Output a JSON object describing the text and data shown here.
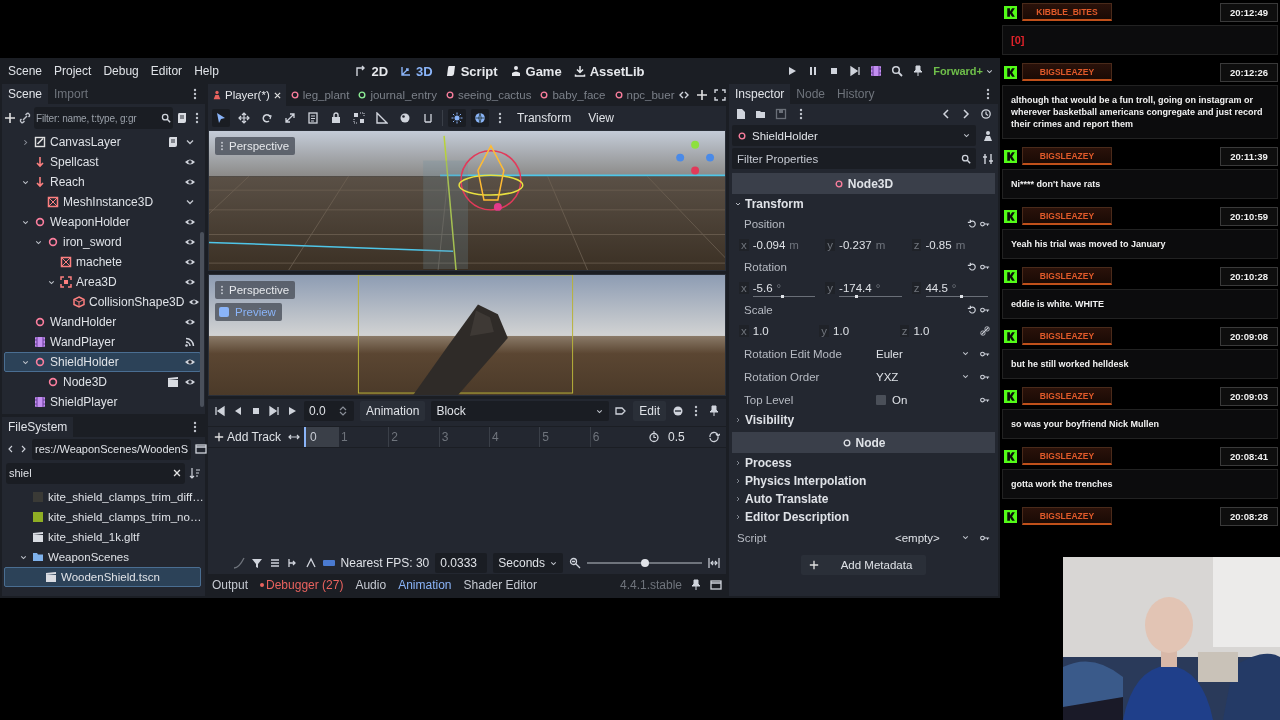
{
  "menu": [
    "Scene",
    "Project",
    "Debug",
    "Editor",
    "Help"
  ],
  "workspaces": [
    {
      "label": "2D",
      "kind": "planar",
      "selected": false
    },
    {
      "label": "3D",
      "kind": "spatial",
      "selected": true
    },
    {
      "label": "Script",
      "kind": "script",
      "selected": false
    },
    {
      "label": "Game",
      "kind": "game",
      "selected": false
    },
    {
      "label": "AssetLib",
      "kind": "assetlib",
      "selected": false
    }
  ],
  "renderer": "Forward+",
  "scene_dock": {
    "tabs": [
      {
        "label": "Scene",
        "selected": true
      },
      {
        "label": "Import",
        "selected": false
      }
    ],
    "filter_placeholder": "Filter: name, t:type, g:gr",
    "tree": [
      {
        "label": "CanvasLayer",
        "kind": "canvas_layer",
        "has_script": true,
        "folded": true,
        "expanded": false,
        "selected": false
      },
      {
        "label": "Spellcast",
        "kind": "marker",
        "visible": true,
        "selected": false
      },
      {
        "label": "Reach",
        "kind": "marker",
        "visible": true,
        "expanded": true,
        "selected": false,
        "children": [
          {
            "label": "MeshInstance3D",
            "kind": "mesh",
            "folded": true,
            "selected": false
          }
        ]
      },
      {
        "label": "WeaponHolder",
        "kind": "node3d",
        "visible": true,
        "expanded": true,
        "selected": false,
        "children": [
          {
            "label": "iron_sword",
            "kind": "node3d",
            "visible": true,
            "expanded": true,
            "selected": false,
            "children": [
              {
                "label": "machete",
                "kind": "mesh",
                "visible": true,
                "selected": false
              },
              {
                "label": "Area3D",
                "kind": "area",
                "visible": true,
                "expanded": true,
                "selected": false,
                "children": [
                  {
                    "label": "CollisionShape3D",
                    "kind": "collision",
                    "visible": true,
                    "selected": false
                  }
                ]
              }
            ]
          }
        ]
      },
      {
        "label": "WandHolder",
        "kind": "node3d",
        "visible": true,
        "selected": false
      },
      {
        "label": "WandPlayer",
        "kind": "animation_player",
        "has_signals": true,
        "selected": false
      },
      {
        "label": "ShieldHolder",
        "kind": "node3d",
        "visible": true,
        "expanded": true,
        "selected": true,
        "children": [
          {
            "label": "Node3D",
            "kind": "node3d",
            "instanced": true,
            "visible": true,
            "selected": false
          }
        ]
      },
      {
        "label": "ShieldPlayer",
        "kind": "animation_player",
        "selected": false
      }
    ]
  },
  "filesystem": {
    "tab": "FileSystem",
    "path": "res://WeaponScenes/WoodenS",
    "search": "shiel",
    "tree": [
      {
        "label": "kite_shield_clamps_trim_diff…",
        "kind": "texture",
        "color": "#3a3a36",
        "selected": false
      },
      {
        "label": "kite_shield_clamps_trim_no…",
        "kind": "texture",
        "color": "#8fae24",
        "selected": false
      },
      {
        "label": "kite_shield_1k.gltf",
        "kind": "scene",
        "selected": false
      },
      {
        "label": "WeaponScenes",
        "kind": "folder",
        "expanded": true,
        "selected": false,
        "children": [
          {
            "label": "WoodenShield.tscn",
            "kind": "scene",
            "selected": true
          }
        ]
      }
    ]
  },
  "scene_tabs": [
    {
      "label": "Player(*)",
      "kind": "character",
      "color": "#e8625e",
      "selected": true
    },
    {
      "label": "leg_plant",
      "kind": "node",
      "color": "#fc7f9e",
      "selected": false
    },
    {
      "label": "journal_entry",
      "kind": "node",
      "color": "#8eef97",
      "selected": false
    },
    {
      "label": "seeing_cactus",
      "kind": "node",
      "color": "#fc7f9e",
      "selected": false
    },
    {
      "label": "baby_face",
      "kind": "node",
      "color": "#fc7f9e",
      "selected": false
    },
    {
      "label": "npc_buer",
      "kind": "node",
      "color": "#fc7f9e",
      "selected": false
    }
  ],
  "viewport_toolbar": {
    "tools": [
      {
        "kind": "select",
        "selected": true
      },
      {
        "kind": "move",
        "selected": false
      },
      {
        "kind": "rotate",
        "selected": false
      },
      {
        "kind": "scale",
        "selected": false
      },
      {
        "kind": "list",
        "selected": false
      },
      {
        "kind": "lock",
        "selected": false
      },
      {
        "kind": "group",
        "selected": false
      },
      {
        "kind": "ruler",
        "selected": false
      },
      {
        "kind": "sphere",
        "selected": false
      },
      {
        "kind": "snap",
        "selected": false
      },
      {
        "kind": "sun",
        "selected": true
      },
      {
        "kind": "globe",
        "selected": true
      }
    ],
    "menus": [
      "Transform",
      "View"
    ]
  },
  "viewports": [
    {
      "label": "Perspective",
      "kind": "editor"
    },
    {
      "label": "Perspective",
      "kind": "camera",
      "preview": {
        "label": "Preview",
        "checked": true
      }
    }
  ],
  "animation": {
    "time": "0.0",
    "menu": "Animation",
    "current": "Block",
    "edit": "Edit",
    "add_track": "Add Track",
    "cursor": "0",
    "ticks": [
      "1",
      "2",
      "3",
      "4",
      "5",
      "6"
    ],
    "length": "0.5",
    "snap_label": "Nearest FPS: 30",
    "step": "0.0333",
    "unit": "Seconds",
    "zoom": {
      "level": 0.5
    }
  },
  "bottom_tabs": [
    {
      "label": "Output",
      "kind": "plain",
      "selected": false
    },
    {
      "label": "Debugger (27)",
      "kind": "alert",
      "selected": false
    },
    {
      "label": "Audio",
      "kind": "plain",
      "selected": false
    },
    {
      "label": "Animation",
      "kind": "plain",
      "selected": true
    },
    {
      "label": "Shader Editor",
      "kind": "plain",
      "selected": false
    }
  ],
  "version": "4.4.1.stable",
  "inspector": {
    "tabs": [
      {
        "label": "Inspector",
        "selected": true
      },
      {
        "label": "Node",
        "selected": false
      },
      {
        "label": "History",
        "selected": false
      }
    ],
    "node_path": "ShieldHolder",
    "filter_placeholder": "Filter Properties",
    "properties": [
      {
        "kind": "class_header",
        "label": "Node3D"
      },
      {
        "kind": "group",
        "label": "Transform",
        "expanded": true
      },
      {
        "kind": "vector",
        "label": "Position",
        "components": [
          {
            "axis": "x",
            "value": "-0.094",
            "unit": "m"
          },
          {
            "axis": "y",
            "value": "-0.237",
            "unit": "m"
          },
          {
            "axis": "z",
            "value": "-0.85",
            "unit": "m"
          }
        ]
      },
      {
        "kind": "vector",
        "label": "Rotation",
        "components": [
          {
            "axis": "x",
            "value": "-5.6",
            "unit": "°",
            "level": 0.47
          },
          {
            "axis": "y",
            "value": "-174.4",
            "unit": "°",
            "level": 0.27
          },
          {
            "axis": "z",
            "value": "44.5",
            "unit": "°",
            "level": 0.57
          }
        ]
      },
      {
        "kind": "vector",
        "label": "Scale",
        "components": [
          {
            "axis": "x",
            "value": "1.0"
          },
          {
            "axis": "y",
            "value": "1.0"
          },
          {
            "axis": "z",
            "value": "1.0"
          }
        ]
      },
      {
        "kind": "dropdown",
        "label": "Rotation Edit Mode",
        "value": "Euler"
      },
      {
        "kind": "dropdown",
        "label": "Rotation Order",
        "value": "YXZ"
      },
      {
        "kind": "checkbox",
        "label": "Top Level",
        "text": "On",
        "checked": false
      },
      {
        "kind": "group",
        "label": "Visibility",
        "expanded": false
      },
      {
        "kind": "class_header",
        "label": "Node"
      },
      {
        "kind": "group",
        "label": "Process",
        "expanded": false
      },
      {
        "kind": "group",
        "label": "Physics Interpolation",
        "expanded": false
      },
      {
        "kind": "group",
        "label": "Auto Translate",
        "expanded": false
      },
      {
        "kind": "group",
        "label": "Editor Description",
        "expanded": false
      },
      {
        "kind": "resource",
        "label": "Script",
        "value": "<empty>"
      }
    ],
    "add_metadata": "Add Metadata"
  },
  "chat": [
    {
      "user": "KIBBLE_BITES",
      "time": "20:12:49",
      "kind": "emote",
      "text": "[0]"
    },
    {
      "user": "BIGSLEAZEY",
      "time": "20:12:26",
      "kind": "text",
      "text": "although that would be a fun troll, going on instagram or wherever basketball americans congregate and just record their crimes and report them"
    },
    {
      "user": "BIGSLEAZEY",
      "time": "20:11:39",
      "kind": "text",
      "text": "Ni**** don't have rats"
    },
    {
      "user": "BIGSLEAZEY",
      "time": "20:10:59",
      "kind": "text",
      "text": "Yeah his trial was moved to January"
    },
    {
      "user": "BIGSLEAZEY",
      "time": "20:10:28",
      "kind": "text",
      "text": "eddie is white. WHITE"
    },
    {
      "user": "BIGSLEAZEY",
      "time": "20:09:08",
      "kind": "text",
      "text": "but he still worked helldesk"
    },
    {
      "user": "BIGSLEAZEY",
      "time": "20:09:03",
      "kind": "text",
      "text": "so was your boyfriend Nick Mullen"
    },
    {
      "user": "BIGSLEAZEY",
      "time": "20:08:41",
      "kind": "text",
      "text": "gotta work the trenches"
    },
    {
      "user": "BIGSLEAZEY",
      "time": "20:08:28"
    }
  ],
  "webcam": {
    "kind": "picture"
  }
}
